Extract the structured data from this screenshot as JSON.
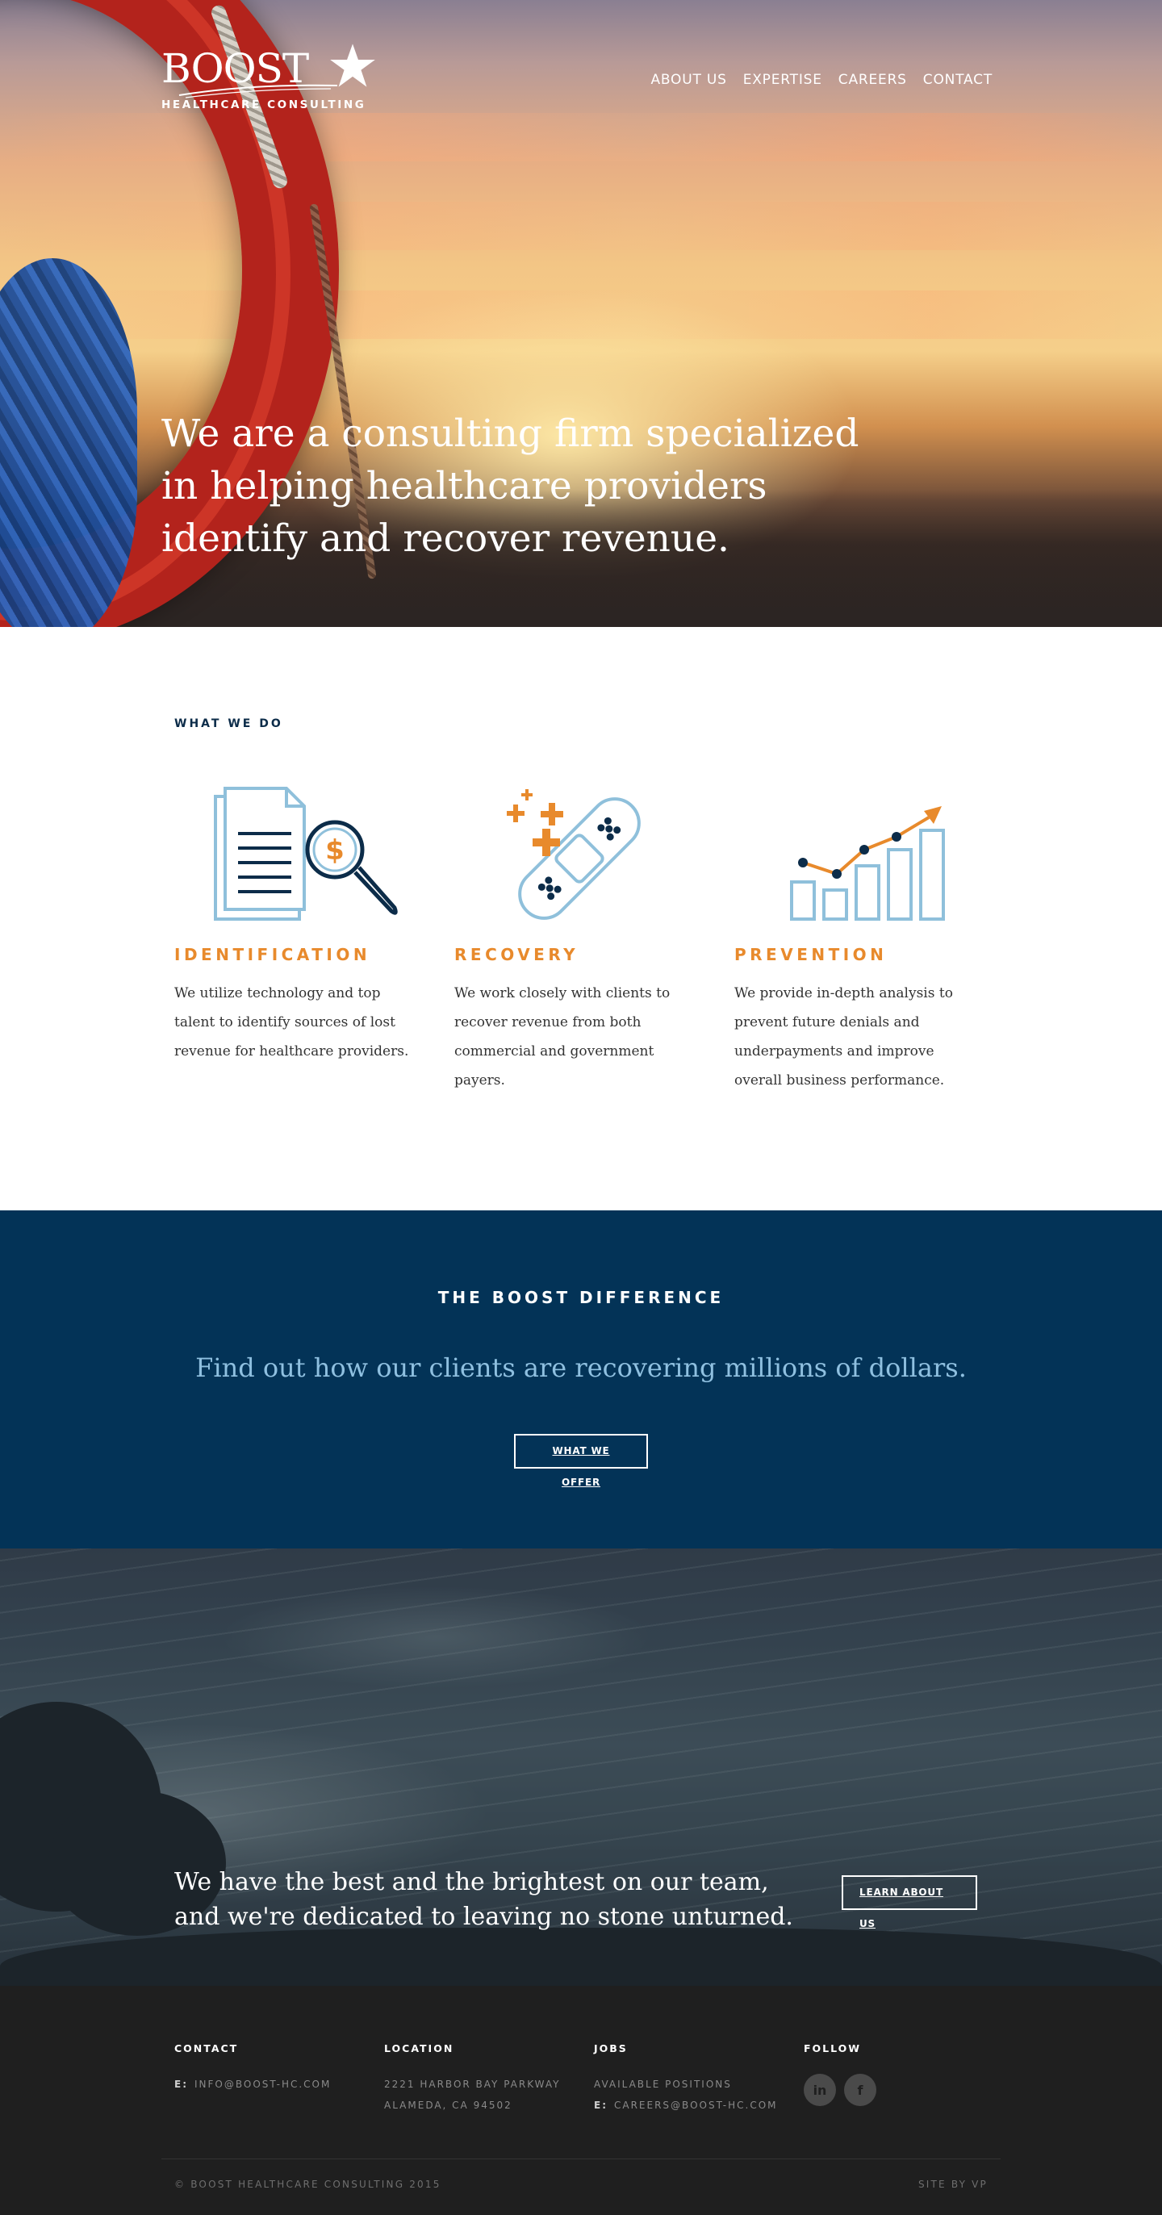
{
  "brand": {
    "logo_word": "BOOST",
    "logo_sub": "HEALTHCARE CONSULTING"
  },
  "nav": {
    "items": [
      {
        "label": "ABOUT US"
      },
      {
        "label": "EXPERTISE"
      },
      {
        "label": "CAREERS"
      },
      {
        "label": "CONTACT"
      }
    ]
  },
  "hero": {
    "title": "We are a consulting firm specialized in helping healthcare providers identify and recover revenue."
  },
  "what_we_do": {
    "eyebrow": "WHAT WE DO",
    "services": [
      {
        "title": "IDENTIFICATION",
        "icon": "document-search-icon",
        "text": "We utilize technology and top talent to identify sources of lost revenue for healthcare providers."
      },
      {
        "title": "RECOVERY",
        "icon": "bandage-icon",
        "text": "We work closely with clients to recover revenue from both commercial and government payers."
      },
      {
        "title": "PREVENTION",
        "icon": "growth-chart-icon",
        "text": "We provide in-depth analysis to prevent future denials and underpayments and improve overall business performance."
      }
    ]
  },
  "difference": {
    "heading": "THE BOOST DIFFERENCE",
    "tagline": "Find out how our clients are recovering millions of dollars.",
    "button": "WHAT WE OFFER"
  },
  "team": {
    "tagline": "We have the best and the brightest on our team, and we're dedicated to leaving no stone unturned.",
    "button": "LEARN ABOUT US"
  },
  "footer": {
    "contact": {
      "heading": "CONTACT",
      "email_label": "E:",
      "email": "INFO@BOOST-HC.COM"
    },
    "location": {
      "heading": "LOCATION",
      "line1": "2221 HARBOR BAY PARKWAY",
      "line2": "ALAMEDA, CA 94502"
    },
    "jobs": {
      "heading": "JOBS",
      "positions": "AVAILABLE POSITIONS",
      "email_label": "E:",
      "email": "CAREERS@BOOST-HC.COM"
    },
    "follow": {
      "heading": "FOLLOW",
      "linkedin": "in",
      "facebook": "f"
    },
    "copyright": "© BOOST HEALTHCARE CONSULTING 2015",
    "credit": "SITE BY VP"
  },
  "colors": {
    "navy": "#033357",
    "orange": "#e88a2c",
    "light_blue": "#8fc0e0",
    "footer_bg": "#1f1f1f"
  }
}
